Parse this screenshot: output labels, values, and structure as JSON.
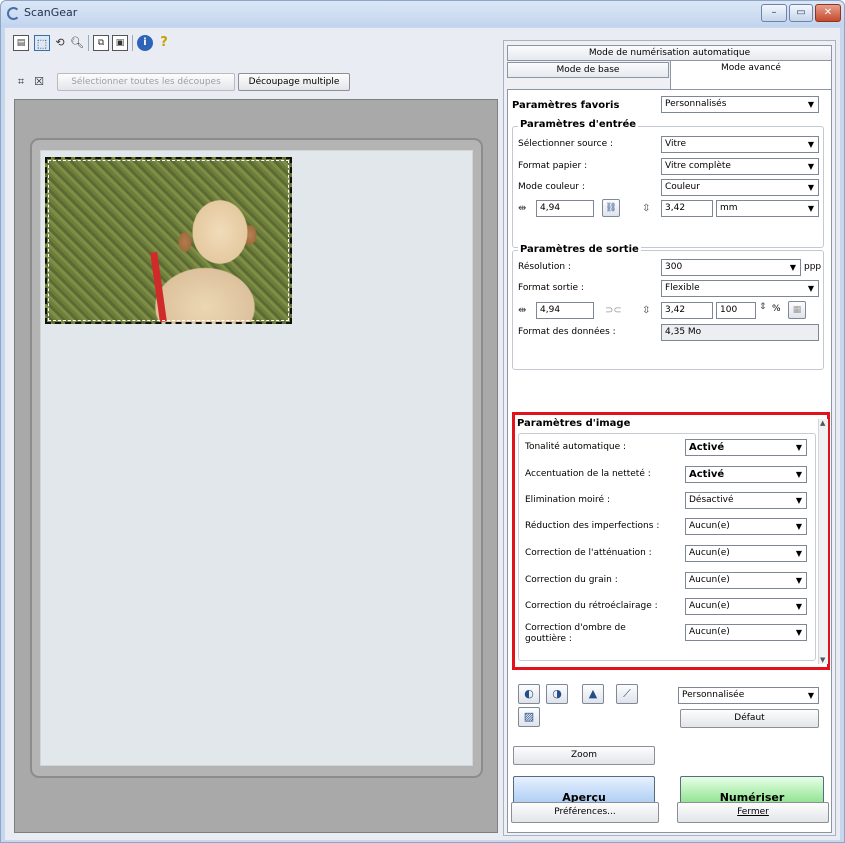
{
  "window": {
    "title": "ScanGear",
    "controls": {
      "minimize": "–",
      "maximize": "▭",
      "close": "✕"
    }
  },
  "toolbar": {
    "select_all_crops": "Sélectionner toutes les découpes",
    "multi_crop": "Découpage multiple",
    "icons": [
      "thumbnail-icon",
      "crop-icon",
      "rotate-icon",
      "zoom-icon",
      "copy-icon",
      "paste-icon",
      "info-icon",
      "help-icon"
    ]
  },
  "tabs": {
    "auto_mode": "Mode de numérisation automatique",
    "basic_mode": "Mode de base",
    "advanced_mode": "Mode avancé"
  },
  "favorites": {
    "label": "Paramètres favoris",
    "value": "Personnalisés"
  },
  "input": {
    "title": "Paramètres d'entrée",
    "source_label": "Sélectionner source :",
    "source_value": "Vitre",
    "paper_label": "Format papier :",
    "paper_value": "Vitre complète",
    "color_label": "Mode couleur :",
    "color_value": "Couleur",
    "width": "4,94",
    "height": "3,42",
    "unit": "mm"
  },
  "output": {
    "title": "Paramètres de sortie",
    "resolution_label": "Résolution :",
    "resolution_value": "300",
    "resolution_unit": "ppp",
    "format_label": "Format sortie :",
    "format_value": "Flexible",
    "width": "4,94",
    "height": "3,42",
    "scale": "100",
    "scale_unit": "%",
    "data_size_label": "Format des données :",
    "data_size_value": "4,35 Mo"
  },
  "image_settings": {
    "title": "Paramètres d'image",
    "rows": [
      {
        "label": "Tonalité automatique :",
        "value": "Activé",
        "bold": true
      },
      {
        "label": "Accentuation de la netteté :",
        "value": "Activé",
        "bold": true
      },
      {
        "label": "Elimination moiré :",
        "value": "Désactivé",
        "bold": false
      },
      {
        "label": "Réduction des imperfections :",
        "value": "Aucun(e)",
        "bold": false
      },
      {
        "label": "Correction de l'atténuation :",
        "value": "Aucun(e)",
        "bold": false
      },
      {
        "label": "Correction du grain :",
        "value": "Aucun(e)",
        "bold": false
      },
      {
        "label": "Correction du rétroéclairage :",
        "value": "Aucun(e)",
        "bold": false
      },
      {
        "label": "Correction d'ombre de",
        "label2": "gouttière :",
        "value": "Aucun(e)",
        "bold": false
      }
    ]
  },
  "adjust": {
    "preset": "Personnalisée",
    "default_button": "Défaut",
    "icons": [
      "brightness-icon",
      "contrast-icon",
      "histogram-icon",
      "tone-curve-icon",
      "final-review-icon"
    ]
  },
  "zoom_button": "Zoom",
  "preview_button": "Aperçu",
  "scan_button": "Numériser",
  "preferences_button": "Préférences...",
  "close_button": "Fermer",
  "colors": {
    "highlight": "#e1121c",
    "preview_button": "#8fb9ec",
    "scan_button": "#5fd35f"
  }
}
